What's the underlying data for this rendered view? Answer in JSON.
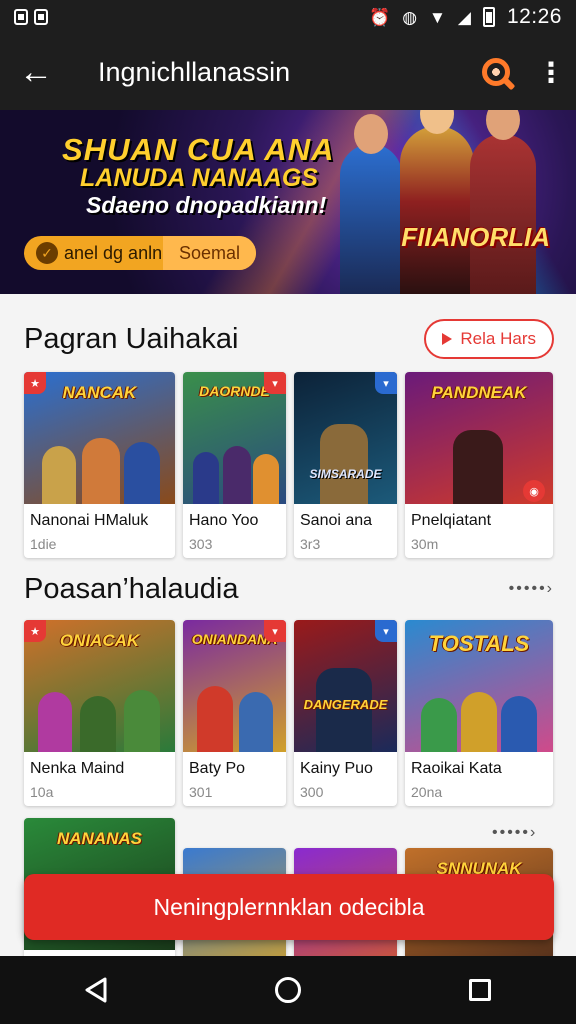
{
  "status_bar": {
    "time": "12:26"
  },
  "app_bar": {
    "title": "Ingnichllanassin"
  },
  "banner": {
    "title": "SHUAN CUA ANA",
    "subtitle": "LANUDA NANAAGS",
    "tagline": "Sdaeno dnopadkiann!",
    "pill_text": "anel dg anln",
    "pill_side": "Soemal",
    "logo": "FIIANORLIA"
  },
  "section1": {
    "title": "Pagran Uaihakai",
    "view_all_label": "Rela Hars",
    "cards": [
      {
        "name": "Nanonai HMaluk",
        "meta": "1die",
        "art": "NANCAK",
        "colors": [
          "#2a6fd0",
          "#8a4a1a"
        ]
      },
      {
        "name": "Hano Yoo",
        "meta": "303",
        "art": "DAORNDE",
        "colors": [
          "#3a8f4a",
          "#2a4a80"
        ]
      },
      {
        "name": "Sanoi ana",
        "meta": "3r3",
        "art": "SIMSARADE",
        "colors": [
          "#0c2238",
          "#1c5a7a"
        ]
      },
      {
        "name": "Pnelqiatant",
        "meta": "30m",
        "art": "PANDNEAK",
        "colors": [
          "#6a1a7a",
          "#d03a2a"
        ]
      }
    ]
  },
  "section2": {
    "title": "Poasan’halaudia",
    "more_label": "•••••›",
    "cards": [
      {
        "name": "Nenka Maind",
        "meta": "10a",
        "art": "ONIACAK",
        "colors": [
          "#d0702a",
          "#2a7a3a"
        ]
      },
      {
        "name": "Baty Po",
        "meta": "301",
        "art": "ONIANDANA",
        "colors": [
          "#7a2aa0",
          "#d0a02a"
        ]
      },
      {
        "name": "Kainy Puo",
        "meta": "300",
        "art": "DANGERADE",
        "colors": [
          "#9a1a1a",
          "#1a2a5a"
        ]
      },
      {
        "name": "Raoikai Kata",
        "meta": "20na",
        "art": "TOSTALS",
        "colors": [
          "#2a8ad0",
          "#d04a8a"
        ]
      }
    ]
  },
  "section3": {
    "more_label": "•••••›",
    "cards": [
      {
        "art": "NANANAS",
        "colors": [
          "#2a8a3a",
          "#1a3a1a"
        ]
      },
      {
        "art": "",
        "colors": [
          "#3a7ad0",
          "#d0a02a"
        ]
      },
      {
        "art": "",
        "colors": [
          "#8a2ad0",
          "#d05a2a"
        ]
      },
      {
        "art": "SNNUNAK",
        "colors": [
          "#c0702a",
          "#4a2a1a"
        ]
      }
    ]
  },
  "toast": {
    "text": "Neningplernnklan odecibla"
  }
}
